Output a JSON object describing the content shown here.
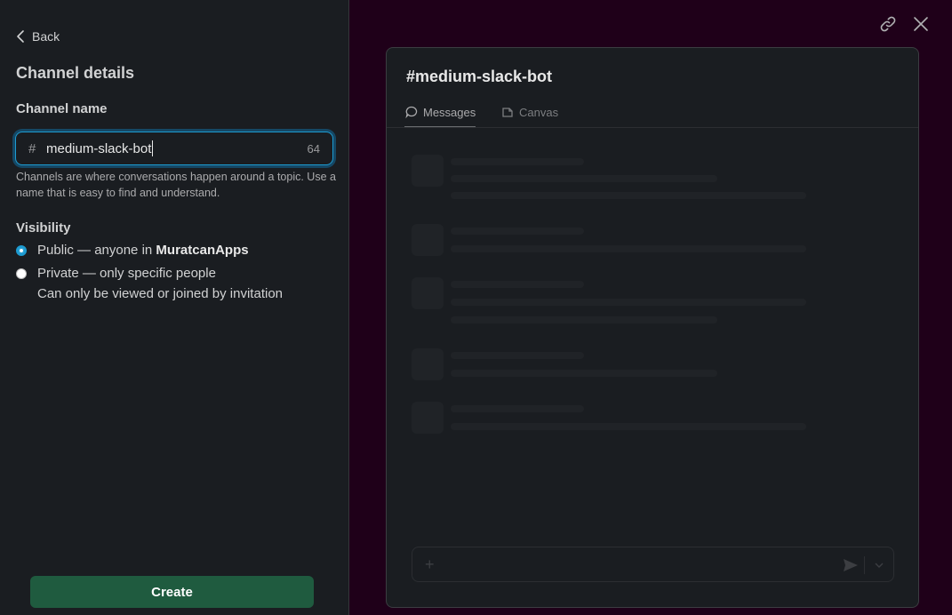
{
  "form": {
    "back_label": "Back",
    "title": "Channel details",
    "channel_name_label": "Channel name",
    "hash_prefix": "#",
    "channel_name_value": "medium-slack-bot",
    "char_count": "64",
    "help_text": "Channels are where conversations happen around a topic. Use a name that is easy to find and understand.",
    "visibility_label": "Visibility",
    "public_option": {
      "label_prefix": "Public — anyone in ",
      "workspace": "MuratcanApps",
      "selected": true
    },
    "private_option": {
      "label": "Private — only specific people",
      "sublabel": "Can only be viewed or joined by invitation",
      "selected": false
    },
    "create_label": "Create"
  },
  "preview": {
    "channel_title": "#medium-slack-bot",
    "tabs": [
      {
        "label": "Messages",
        "icon": "message-bubble-icon",
        "active": true
      },
      {
        "label": "Canvas",
        "icon": "canvas-icon",
        "active": false
      }
    ],
    "composer": {
      "add_icon": "plus-icon",
      "send_icon": "send-icon",
      "options_icon": "chevron-down-icon"
    }
  },
  "window_actions": {
    "copy_link_icon": "link-icon",
    "close_icon": "close-icon"
  },
  "colors": {
    "accent_blue": "#1d9bd1",
    "create_button": "#1f5b3f",
    "panel_bg": "#1a1d21",
    "backdrop": "#1f0019"
  }
}
